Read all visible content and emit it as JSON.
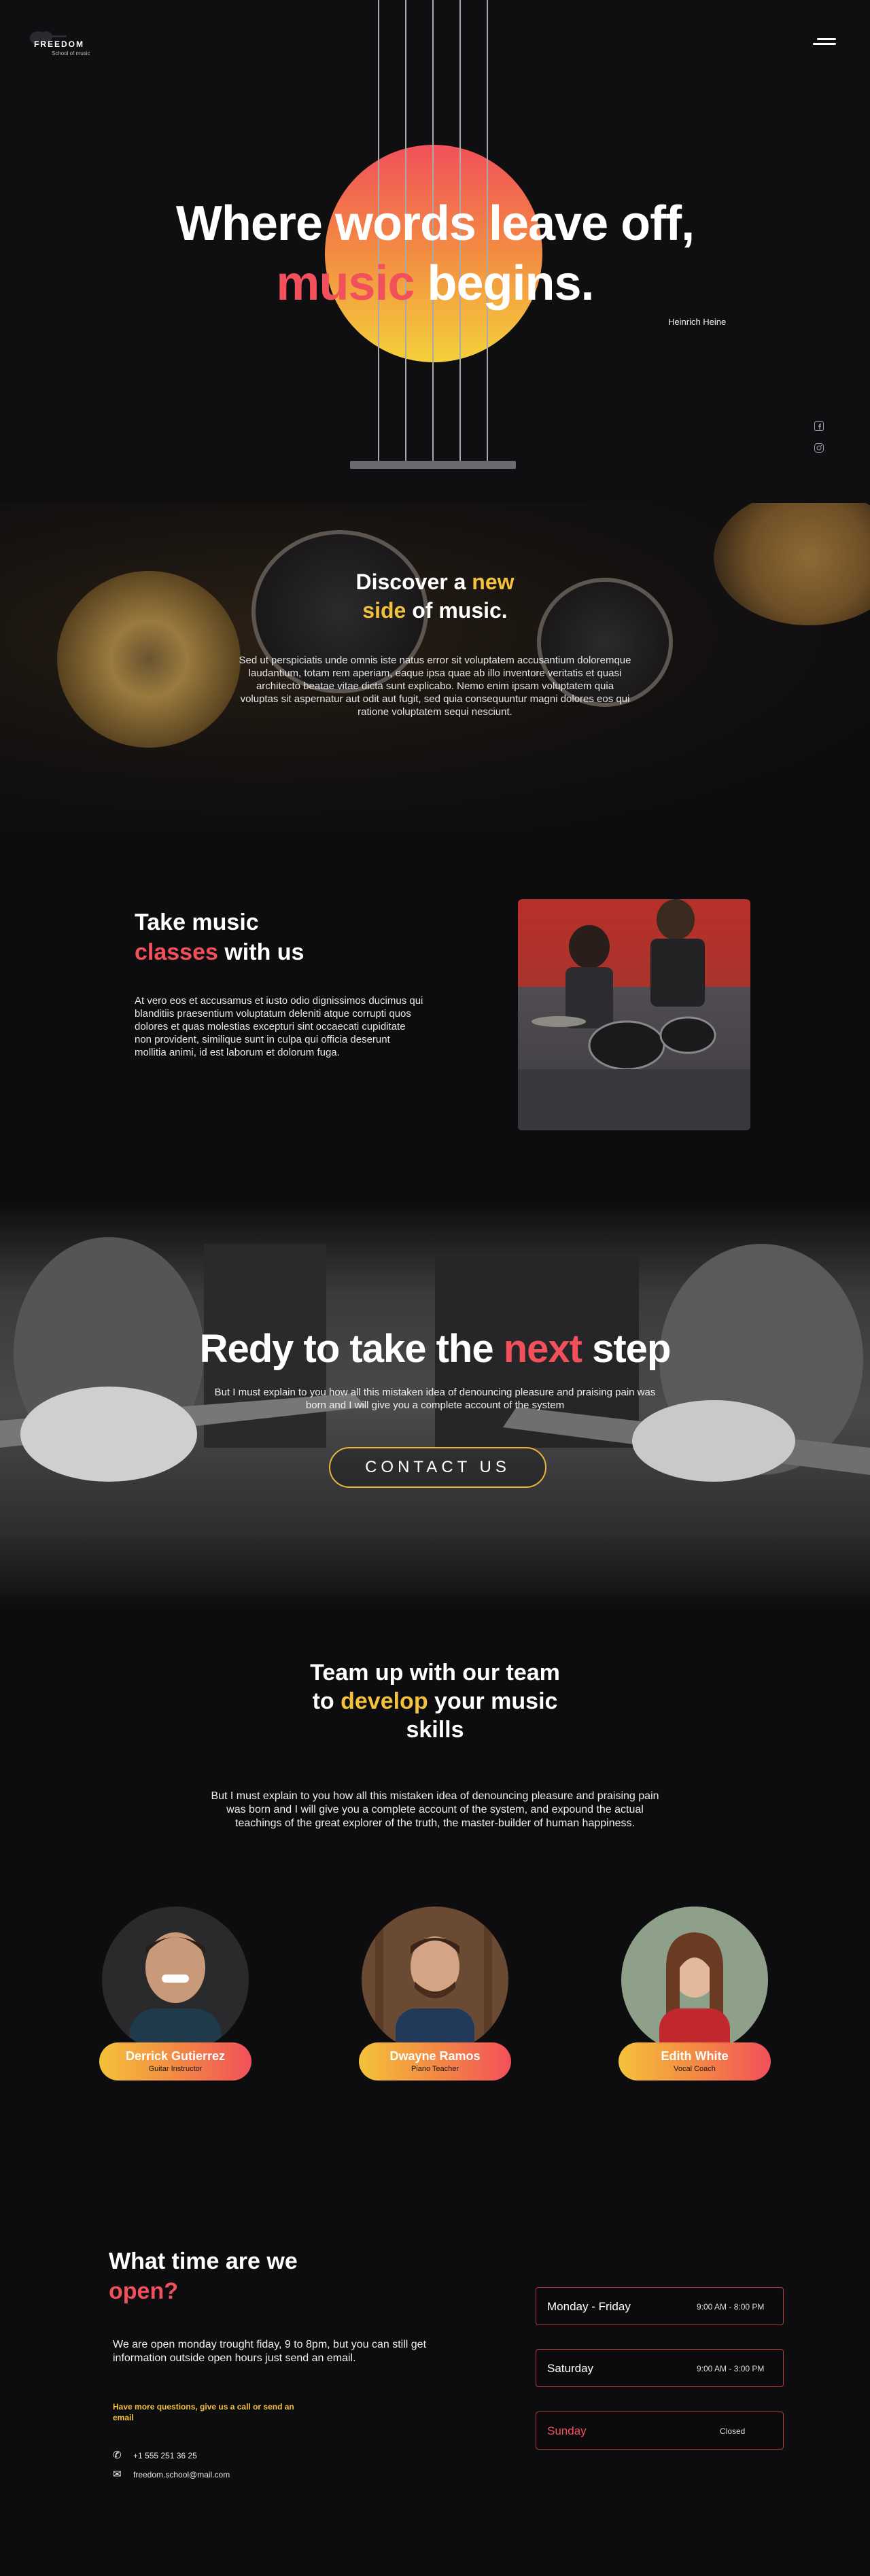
{
  "header": {
    "logo_text": "FREEDOM",
    "logo_sub": "School of music"
  },
  "hero": {
    "title_line1": "Where words leave off,",
    "title_line2_red": "music",
    "title_line2_rest": " begins.",
    "author": "Heinrich Heine",
    "social": [
      "facebook-icon",
      "instagram-icon"
    ]
  },
  "discover": {
    "title_a": "Discover a ",
    "title_new": "new",
    "title_side": "side",
    "title_b": " of music.",
    "text": "Sed ut perspiciatis unde omnis iste natus error sit voluptatem accusantium doloremque laudantium, totam rem aperiam, eaque ipsa quae ab illo inventore veritatis et quasi architecto beatae vitae dicta sunt explicabo. Nemo enim ipsam voluptatem quia voluptas sit aspernatur aut odit aut fugit, sed quia consequuntur magni dolores eos qui ratione voluptatem sequi nesciunt."
  },
  "classes": {
    "title_a": "Take music",
    "title_red": "classes",
    "title_b": " with us",
    "text": "At vero eos et accusamus et iusto odio dignissimos ducimus qui blanditiis praesentium voluptatum deleniti atque corrupti quos dolores et quas molestias excepturi sint occaecati cupiditate non provident, similique sunt in culpa qui officia deserunt mollitia animi, id est laborum et dolorum fuga."
  },
  "cta": {
    "title_a": "Redy to take the ",
    "title_red": "next",
    "title_b": " step",
    "text": "But I must explain to you how all this mistaken idea of denouncing pleasure and praising pain was born and I will give you a complete account of the system",
    "button": "CONTACT US"
  },
  "team": {
    "title_a": "Team up with our team",
    "title_to": "to ",
    "title_yellow": "develop",
    "title_b": " your music",
    "title_c": "skills",
    "text": "But I must explain to you how all this mistaken idea of denouncing pleasure and praising pain was born and I will give you a complete account of the system, and expound the actual teachings of the great explorer of the truth, the master-builder of human happiness.",
    "members": [
      {
        "name": "Derrick Gutierrez",
        "role": "Guitar Instructor"
      },
      {
        "name": "Dwayne Ramos",
        "role": "Piano Teacher"
      },
      {
        "name": "Edith White",
        "role": "Vocal Coach"
      }
    ]
  },
  "hours": {
    "title_a": "What time are we",
    "title_red": "open?",
    "text": "We are open monday trought fiday, 9 to 8pm, but you can still get information outside open hours just send an email.",
    "note": "Have more questions, give us a call or send an email",
    "phone": "+1 555 251 36 25",
    "email": "freedom.school@mail.com",
    "schedule": [
      {
        "day": "Monday - Friday",
        "time": "9:00 AM - 8:00 PM"
      },
      {
        "day": "Saturday",
        "time": "9:00 AM - 3:00 PM"
      },
      {
        "day": "Sunday",
        "time": "Closed"
      }
    ]
  },
  "colors": {
    "background": "#0d0c0f",
    "accent_red": "#f2505a",
    "accent_yellow": "#f4c23a",
    "accent_orange": "#f38a43"
  }
}
